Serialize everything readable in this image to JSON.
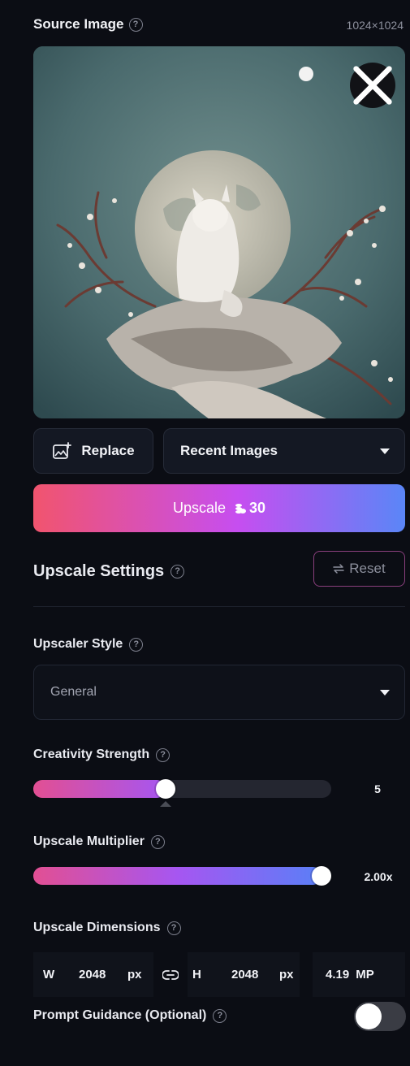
{
  "header": {
    "title": "Source Image",
    "dimensions": "1024×1024"
  },
  "image": {
    "subject": "white cat on rock with blossoming branches and moon",
    "close_icon": "close-icon"
  },
  "actions": {
    "replace_label": "Replace",
    "recent_images_label": "Recent Images",
    "upscale_label": "Upscale",
    "upscale_cost": "30"
  },
  "settings": {
    "title": "Upscale Settings",
    "reset_label": "Reset",
    "style": {
      "label": "Upscaler Style",
      "value": "General"
    },
    "creativity": {
      "label": "Creativity Strength",
      "value": "5",
      "level": 0.44
    },
    "multiplier": {
      "label": "Upscale Multiplier",
      "value": "2.00x",
      "level": 1.0
    },
    "dimensions": {
      "label": "Upscale Dimensions",
      "w_label": "W",
      "w_value": "2048",
      "w_unit": "px",
      "h_label": "H",
      "h_value": "2048",
      "h_unit": "px",
      "mp_value": "4.19",
      "mp_unit": "MP"
    },
    "prompt_guidance": {
      "label": "Prompt Guidance (Optional)",
      "enabled": false
    }
  },
  "colors": {
    "background": "#0b0d14",
    "accent_start": "#f1546e",
    "accent_mid": "#c64ef0",
    "accent_end": "#5a86f7"
  }
}
